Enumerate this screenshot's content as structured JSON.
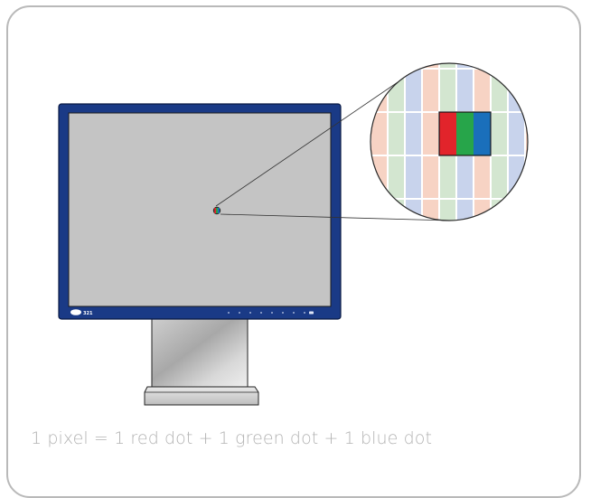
{
  "caption": "1 pixel = 1 red dot + 1 green dot + 1 blue dot",
  "monitor": {
    "brand_logo": "LaCie",
    "model_label": "321",
    "bezel_color": "#1a3a86",
    "screen_color": "#c4c4c4"
  },
  "pixel_dots": {
    "red": "#e2242b",
    "green": "#27a54a",
    "blue": "#1a6fbb"
  },
  "tint_colors": {
    "red": "#f7d3c4",
    "green": "#d3e6d0",
    "blue": "#c8d3ec",
    "grid": "#ffffff"
  }
}
